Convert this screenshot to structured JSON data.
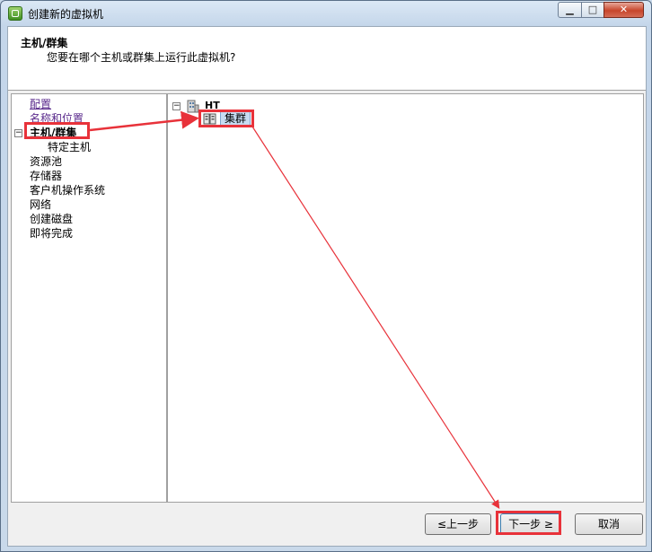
{
  "window": {
    "title": "创建新的虚拟机",
    "minimize_glyph": "▁",
    "maximize_glyph": "□",
    "close_glyph": "✕"
  },
  "header": {
    "title": "主机/群集",
    "subtitle": "您要在哪个主机或群集上运行此虚拟机?"
  },
  "nav": {
    "items": [
      {
        "label": "配置"
      },
      {
        "label": "名称和位置"
      },
      {
        "label": "主机/群集"
      },
      {
        "label": "特定主机"
      },
      {
        "label": "资源池"
      },
      {
        "label": "存储器"
      },
      {
        "label": "客户机操作系统"
      },
      {
        "label": "网络"
      },
      {
        "label": "创建磁盘"
      },
      {
        "label": "即将完成"
      }
    ],
    "expander": "⊟"
  },
  "tree": {
    "expander": "−",
    "datacenter_label": "HT",
    "cluster_label": "集群"
  },
  "buttons": {
    "back": "≤上一步",
    "next": "下一步 ≥",
    "cancel": "取消"
  },
  "colors": {
    "highlight": "#e8323a",
    "link": "#5a2a8c",
    "selection": "#c7dcf2"
  }
}
